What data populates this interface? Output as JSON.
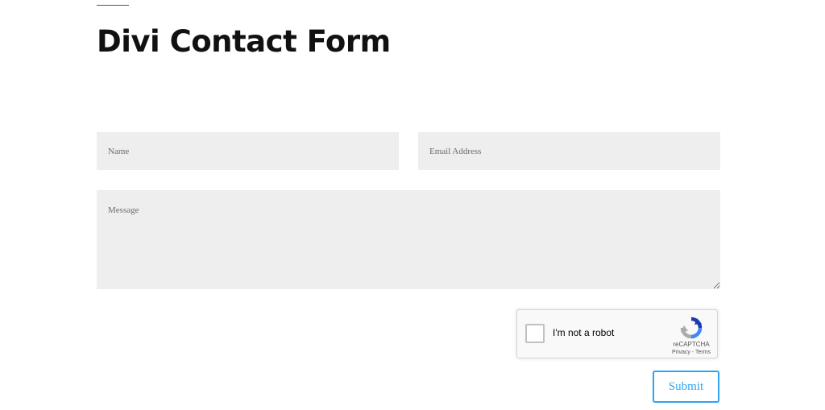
{
  "page": {
    "title": "Divi Contact Form"
  },
  "form": {
    "name_placeholder": "Name",
    "email_placeholder": "Email Address",
    "message_placeholder": "Message",
    "submit_label": "Submit"
  },
  "recaptcha": {
    "label": "I'm not a robot",
    "brand": "reCAPTCHA",
    "privacy": "Privacy",
    "separator": " - ",
    "terms": "Terms"
  },
  "colors": {
    "accent": "#2ea3f2",
    "field_background": "#eeeeee",
    "title": "#111111"
  },
  "icons": {
    "recaptcha_logo": "recaptcha-logo-icon"
  }
}
